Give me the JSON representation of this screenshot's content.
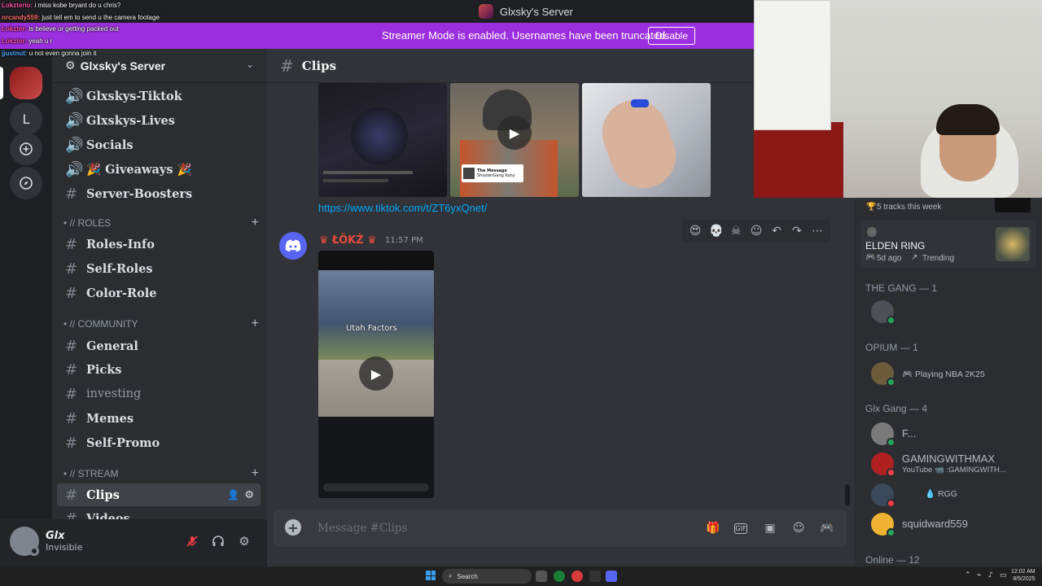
{
  "window": {
    "title": "Glxsky's Server"
  },
  "banner": {
    "text": "Streamer Mode is enabled. Usernames have been truncated.",
    "button": "Disable"
  },
  "chat_overlay": [
    {
      "user": "Lokzterio:",
      "text": "i miss kobe bryant do u chris?",
      "color": "#ff4da6"
    },
    {
      "user": "nrcandy559:",
      "text": "just tell em to send u the camera footage",
      "color": "#ff6b6b"
    },
    {
      "user": "Lokzter:",
      "text": "is believe ur getting packed out",
      "color": "#ff4da6"
    },
    {
      "user": "Lokzter:",
      "text": "yeah u r",
      "color": "#ff4da6"
    },
    {
      "user": "jjustnut:",
      "text": "u not even gonna join it",
      "color": "#4da6ff"
    }
  ],
  "rail": {
    "letter_server": "L",
    "add_icon": "+",
    "explore_icon": "compass"
  },
  "sidebar": {
    "server_name": "Glxsky's Server",
    "channels_top": [
      {
        "label": "Glxskys-Tiktok",
        "icon": "speaker-icon"
      },
      {
        "label": "Glxskys-Lives",
        "icon": "speaker-icon"
      },
      {
        "label": "Socials",
        "icon": "speaker-icon"
      },
      {
        "label": "🎉 Giveaways 🎉",
        "icon": "speaker-icon"
      },
      {
        "label": "Server-Boosters",
        "icon": "hash-icon"
      }
    ],
    "cat_roles": "• // ROLES",
    "roles_channels": [
      "Roles-Info",
      "Self-Roles",
      "Color-Role"
    ],
    "cat_community": "• // COMMUNITY",
    "community_channels": [
      "General",
      "Picks",
      "investing",
      "Memes",
      "Self-Promo"
    ],
    "cat_stream": "• // STREAM",
    "stream_channels": [
      "Clips",
      "Videos"
    ]
  },
  "user": {
    "name": "Glx",
    "status": "Invisible"
  },
  "main": {
    "channel": "Clips",
    "link": "https://www.tiktok.com/t/ZT6yxQnet/",
    "message": {
      "author": "♛ ŁÖKŻ ♛",
      "time": "11:57 PM"
    },
    "thumb_caption": "The Message",
    "thumb_sub": "ShooterGang Kony",
    "video_caption": "Utah Factors",
    "composer_placeholder": "Message #Clips"
  },
  "members": {
    "partial_top": "5 tracks this week",
    "elden": {
      "name": "ELDEN RING",
      "meta": "5d ago",
      "trend": "Trending"
    },
    "sections": [
      {
        "title": "THE GANG — 1"
      },
      {
        "title": "OPIUM — 1"
      },
      {
        "title": "Glx Gang — 4"
      },
      {
        "title": "Online — 12"
      }
    ],
    "opium_activity": "Playing NBA 2K25",
    "glx_gang": [
      {
        "name": "F...",
        "sub": ""
      },
      {
        "name": "GAMINGWITHMAX",
        "sub": "YouTube 📹 :GAMINGWITH..."
      },
      {
        "name": "",
        "sub": "",
        "badge": "RGG"
      },
      {
        "name": "squidward559",
        "sub": ""
      }
    ]
  },
  "taskbar": {
    "search": "Search",
    "time": "12:02 AM",
    "date": "8/5/2025"
  },
  "colors": {
    "blurple": "#5865f2",
    "streamer": "#9b2fdf",
    "online": "#23a55a",
    "dnd": "#f23f43"
  }
}
